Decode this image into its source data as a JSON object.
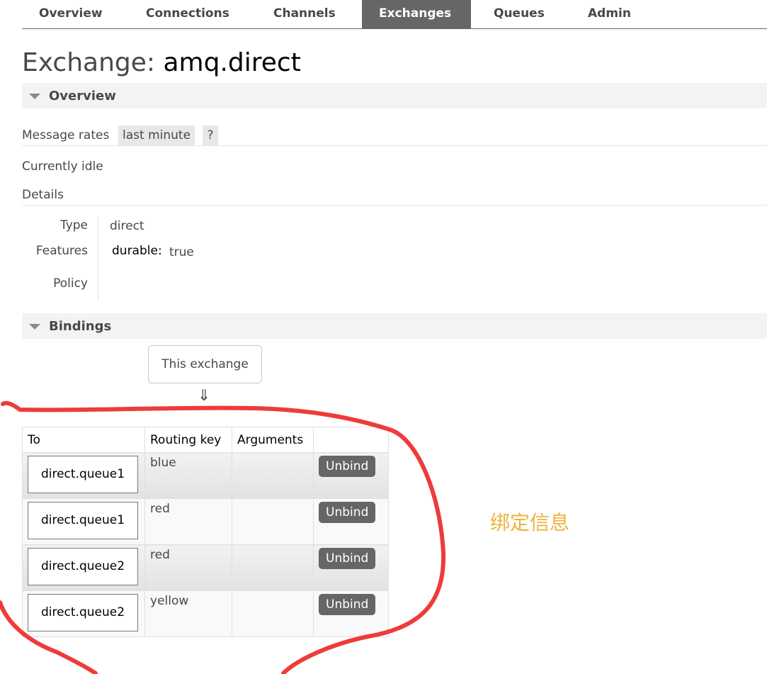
{
  "nav": {
    "tabs": [
      {
        "label": "Overview"
      },
      {
        "label": "Connections"
      },
      {
        "label": "Channels"
      },
      {
        "label": "Exchanges"
      },
      {
        "label": "Queues"
      },
      {
        "label": "Admin"
      }
    ],
    "active": "Exchanges"
  },
  "page": {
    "title_prefix": "Exchange:",
    "exchange_name": "amq.direct"
  },
  "overview": {
    "section_label": "Overview",
    "message_rates_label": "Message rates",
    "message_rates_value": "last minute",
    "help_label": "?",
    "status": "Currently idle",
    "details_label": "Details",
    "details": {
      "type_label": "Type",
      "type_value": "direct",
      "features_label": "Features",
      "features_key": "durable:",
      "features_value": "true",
      "policy_label": "Policy",
      "policy_value": ""
    }
  },
  "bindings": {
    "section_label": "Bindings",
    "this_exchange": "This exchange",
    "arrow": "⇓",
    "columns": [
      "To",
      "Routing key",
      "Arguments",
      ""
    ],
    "rows": [
      {
        "to": "direct.queue1",
        "routing_key": "blue",
        "arguments": "",
        "action": "Unbind"
      },
      {
        "to": "direct.queue1",
        "routing_key": "red",
        "arguments": "",
        "action": "Unbind"
      },
      {
        "to": "direct.queue2",
        "routing_key": "red",
        "arguments": "",
        "action": "Unbind"
      },
      {
        "to": "direct.queue2",
        "routing_key": "yellow",
        "arguments": "",
        "action": "Unbind"
      }
    ]
  },
  "annotation": {
    "text": "绑定信息",
    "text_color": "#f0b23a",
    "circle_color": "#ee3b3b"
  }
}
